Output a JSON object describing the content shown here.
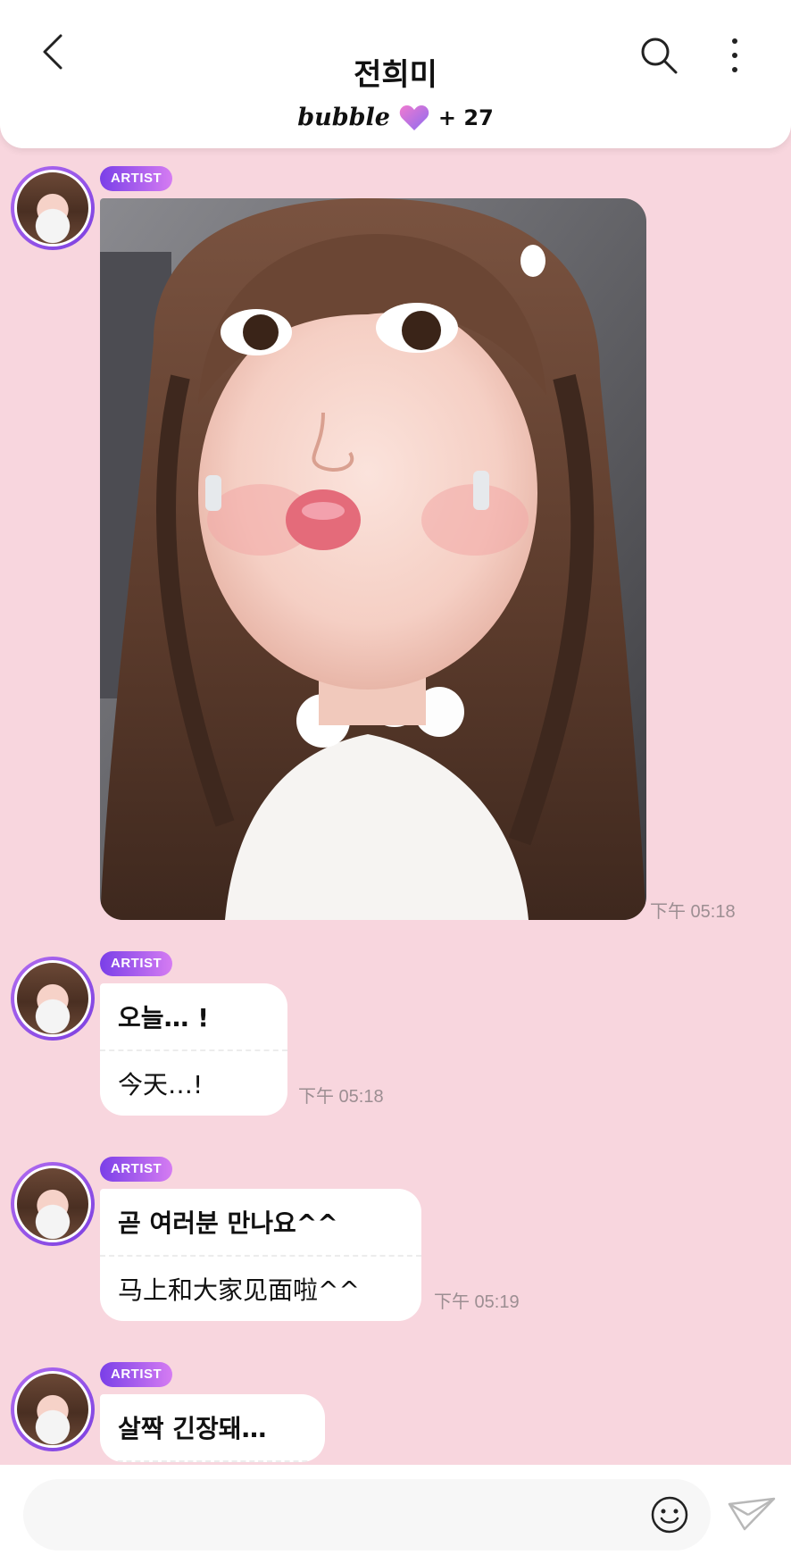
{
  "header": {
    "title": "전희미",
    "brand": "bubble",
    "count": "+ 27"
  },
  "messages": [
    {
      "type": "photo",
      "badge": "ARTIST",
      "time": "下午 05:18"
    },
    {
      "type": "text",
      "badge": "ARTIST",
      "ko": "오늘… !",
      "zh": "今天…!",
      "time": "下午 05:18"
    },
    {
      "type": "text",
      "badge": "ARTIST",
      "ko": "곧 여러분 만나요^^",
      "zh": "马上和大家见面啦^^",
      "time": "下午 05:19"
    },
    {
      "type": "text",
      "badge": "ARTIST",
      "ko": "살짝 긴장돼…",
      "zh": ""
    }
  ],
  "icons": {
    "back": "chevron-left-icon",
    "search": "search-icon",
    "more": "more-vertical-icon",
    "heart": "heart-icon",
    "emoji": "smiley-icon",
    "send": "paper-plane-icon"
  },
  "colors": {
    "background": "#f8d6de",
    "badge_start": "#7a3fe8",
    "badge_end": "#d57cf2",
    "heart_start": "#f07ad0",
    "heart_end": "#8c6cf0"
  }
}
